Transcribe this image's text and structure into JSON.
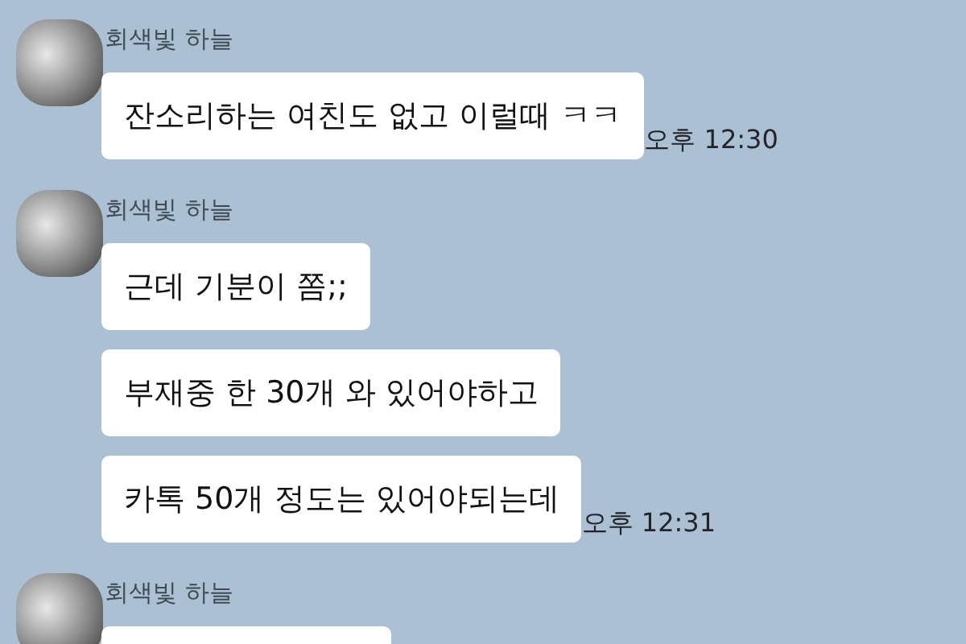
{
  "messages_groups": [
    {
      "sender": "회색빛 하늘",
      "messages": [
        {
          "kind": "text",
          "text": "잔소리하는 여친도 없고 이럴때 ㅋㅋ",
          "time": "오후 12:30"
        }
      ]
    },
    {
      "sender": "회색빛 하늘",
      "messages": [
        {
          "kind": "text",
          "text": "근데 기분이 쫌;;"
        },
        {
          "kind": "text",
          "text": "부재중 한 30개 와 있어야하고"
        },
        {
          "kind": "text",
          "text": "카톡 50개 정도는 있어야되는데",
          "time": "오후 12:31"
        }
      ]
    },
    {
      "sender": "회색빛 하늘",
      "messages": [
        {
          "kind": "cut-off"
        }
      ]
    }
  ]
}
